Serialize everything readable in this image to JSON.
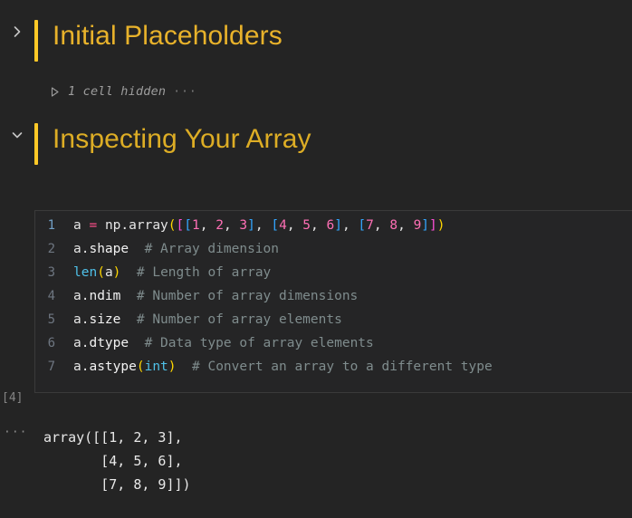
{
  "theme": {
    "background": "#242424",
    "cell_background": "#252526",
    "accent_amber": "#ffc927",
    "heading_color": "#ddad25",
    "border": "#3a3a3a",
    "comment": "#7f8c8d",
    "number": "#ff6fb5",
    "function": "#4fc1e9",
    "bracket_yellow": "#ffd700",
    "bracket_pink": "#ff4fd8",
    "bracket_blue": "#33a6ff"
  },
  "sections": [
    {
      "chevron": "chevron-right-icon",
      "state": "collapsed",
      "title": "Initial Placeholders",
      "hidden_cell": {
        "triangle": "play-triangle-icon",
        "label": "1 cell hidden",
        "ellipsis": "···"
      }
    },
    {
      "chevron": "chevron-down-icon",
      "state": "expanded",
      "title": "Inspecting Your Array"
    }
  ],
  "code_cell": {
    "language": "python",
    "lines": [
      {
        "number": "1",
        "active": true,
        "tokens": [
          {
            "t": "a",
            "c": "t-plain"
          },
          {
            "t": " ",
            "c": "t-plain"
          },
          {
            "t": "=",
            "c": "t-op"
          },
          {
            "t": " ",
            "c": "t-plain"
          },
          {
            "t": "np",
            "c": "t-mod"
          },
          {
            "t": ".",
            "c": "t-plain"
          },
          {
            "t": "array",
            "c": "t-plain"
          },
          {
            "t": "(",
            "c": "t-br-y"
          },
          {
            "t": "[",
            "c": "t-br-p"
          },
          {
            "t": "[",
            "c": "t-br-b"
          },
          {
            "t": "1",
            "c": "t-num"
          },
          {
            "t": ", ",
            "c": "t-plain"
          },
          {
            "t": "2",
            "c": "t-num"
          },
          {
            "t": ", ",
            "c": "t-plain"
          },
          {
            "t": "3",
            "c": "t-num"
          },
          {
            "t": "]",
            "c": "t-br-b"
          },
          {
            "t": ", ",
            "c": "t-plain"
          },
          {
            "t": "[",
            "c": "t-br-b"
          },
          {
            "t": "4",
            "c": "t-num"
          },
          {
            "t": ", ",
            "c": "t-plain"
          },
          {
            "t": "5",
            "c": "t-num"
          },
          {
            "t": ", ",
            "c": "t-plain"
          },
          {
            "t": "6",
            "c": "t-num"
          },
          {
            "t": "]",
            "c": "t-br-b"
          },
          {
            "t": ", ",
            "c": "t-plain"
          },
          {
            "t": "[",
            "c": "t-br-b"
          },
          {
            "t": "7",
            "c": "t-num"
          },
          {
            "t": ", ",
            "c": "t-plain"
          },
          {
            "t": "8",
            "c": "t-num"
          },
          {
            "t": ", ",
            "c": "t-plain"
          },
          {
            "t": "9",
            "c": "t-num"
          },
          {
            "t": "]",
            "c": "t-br-b"
          },
          {
            "t": "]",
            "c": "t-br-p"
          },
          {
            "t": ")",
            "c": "t-br-y"
          }
        ],
        "plain": "a = np.array([[1, 2, 3], [4, 5, 6], [7, 8, 9]])"
      },
      {
        "number": "2",
        "active": false,
        "tokens": [
          {
            "t": "a",
            "c": "t-plain"
          },
          {
            "t": ".",
            "c": "t-plain"
          },
          {
            "t": "shape",
            "c": "t-attr"
          },
          {
            "t": "  ",
            "c": "t-plain"
          },
          {
            "t": "# Array dimension",
            "c": "t-comment"
          }
        ],
        "plain": "a.shape  # Array dimension"
      },
      {
        "number": "3",
        "active": false,
        "tokens": [
          {
            "t": "len",
            "c": "t-fn"
          },
          {
            "t": "(",
            "c": "t-br-y"
          },
          {
            "t": "a",
            "c": "t-plain"
          },
          {
            "t": ")",
            "c": "t-br-y"
          },
          {
            "t": "  ",
            "c": "t-plain"
          },
          {
            "t": "# Length of array",
            "c": "t-comment"
          }
        ],
        "plain": "len(a)  # Length of array"
      },
      {
        "number": "4",
        "active": false,
        "tokens": [
          {
            "t": "a",
            "c": "t-plain"
          },
          {
            "t": ".",
            "c": "t-plain"
          },
          {
            "t": "ndim",
            "c": "t-attr"
          },
          {
            "t": "  ",
            "c": "t-plain"
          },
          {
            "t": "# Number of array dimensions",
            "c": "t-comment"
          }
        ],
        "plain": "a.ndim  # Number of array dimensions"
      },
      {
        "number": "5",
        "active": false,
        "tokens": [
          {
            "t": "a",
            "c": "t-plain"
          },
          {
            "t": ".",
            "c": "t-plain"
          },
          {
            "t": "size",
            "c": "t-attr"
          },
          {
            "t": "  ",
            "c": "t-plain"
          },
          {
            "t": "# Number of array elements",
            "c": "t-comment"
          }
        ],
        "plain": "a.size  # Number of array elements"
      },
      {
        "number": "6",
        "active": false,
        "tokens": [
          {
            "t": "a",
            "c": "t-plain"
          },
          {
            "t": ".",
            "c": "t-plain"
          },
          {
            "t": "dtype",
            "c": "t-attr"
          },
          {
            "t": "  ",
            "c": "t-plain"
          },
          {
            "t": "# Data type of array elements",
            "c": "t-comment"
          }
        ],
        "plain": "a.dtype  # Data type of array elements"
      },
      {
        "number": "7",
        "active": false,
        "tokens": [
          {
            "t": "a",
            "c": "t-plain"
          },
          {
            "t": ".",
            "c": "t-plain"
          },
          {
            "t": "astype",
            "c": "t-attr"
          },
          {
            "t": "(",
            "c": "t-br-y"
          },
          {
            "t": "int",
            "c": "t-kw"
          },
          {
            "t": ")",
            "c": "t-br-y"
          },
          {
            "t": "  ",
            "c": "t-plain"
          },
          {
            "t": "# Convert an array to a different type",
            "c": "t-comment"
          }
        ],
        "plain": "a.astype(int)  # Convert an array to a different type"
      }
    ]
  },
  "output": {
    "execution_count": "[4]",
    "gutter_ellipsis": "···",
    "text": "array([[1, 2, 3],\n       [4, 5, 6],\n       [7, 8, 9]])"
  }
}
